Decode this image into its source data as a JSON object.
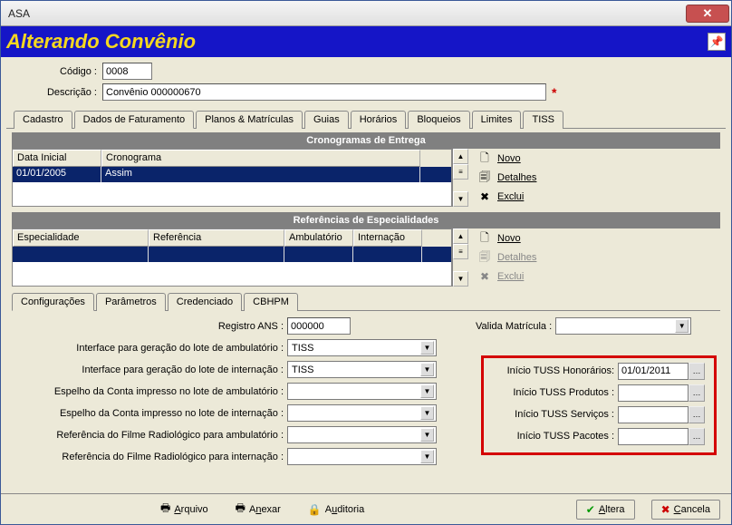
{
  "window": {
    "app_title": "ASA"
  },
  "header": {
    "title": "Alterando Convênio"
  },
  "form": {
    "codigo_label": "Código :",
    "codigo_value": "0008",
    "descricao_label": "Descrição :",
    "descricao_value": "Convênio 000000670"
  },
  "tabs": {
    "cadastro": "Cadastro",
    "dados_fat": "Dados de Faturamento",
    "planos": "Planos & Matrículas",
    "guias": "Guias",
    "horarios": "Horários",
    "bloqueios": "Bloqueios",
    "limites": "Limites",
    "tiss": "TISS"
  },
  "cronogramas": {
    "title": "Cronogramas de Entrega",
    "col_data": "Data Inicial",
    "col_crono": "Cronograma",
    "row0": {
      "data": "01/01/2005",
      "crono": "Assim"
    }
  },
  "refesp": {
    "title": "Referências de Especialidades",
    "col_esp": "Especialidade",
    "col_ref": "Referência",
    "col_amb": "Ambulatório",
    "col_int": "Internação"
  },
  "actions": {
    "novo": "Novo",
    "detalhes": "Detalhes",
    "exclui": "Exclui"
  },
  "subtabs": {
    "config": "Configurações",
    "param": "Parâmetros",
    "cred": "Credenciado",
    "cbhpm": "CBHPM"
  },
  "config": {
    "registro_ans_label": "Registro ANS :",
    "registro_ans_value": "000000",
    "interface_amb_label": "Interface para geração do lote de ambulatório :",
    "interface_amb_value": "TISS",
    "interface_int_label": "Interface para geração do lote de internação :",
    "interface_int_value": "TISS",
    "espelho_amb_label": "Espelho da Conta impresso no lote de ambulatório :",
    "espelho_amb_value": "",
    "espelho_int_label": "Espelho da Conta impresso no lote de internação :",
    "espelho_int_value": "",
    "ref_filme_amb_label": "Referência do Filme Radiológico para ambulatório :",
    "ref_filme_amb_value": "",
    "ref_filme_int_label": "Referência do Filme Radiológico para internação :",
    "ref_filme_int_value": "",
    "valida_matricula_label": "Valida Matrícula :",
    "valida_matricula_value": ""
  },
  "tuss": {
    "honorarios_label": "Início TUSS Honorários:",
    "honorarios_value": "01/01/2011",
    "produtos_label": "Início TUSS Produtos :",
    "produtos_value": "",
    "servicos_label": "Início TUSS Serviços :",
    "servicos_value": "",
    "pacotes_label": "Início TUSS Pacotes :",
    "pacotes_value": ""
  },
  "bottom": {
    "arquivo": "Arquivo",
    "anexar": "Anexar",
    "auditoria": "Auditoria",
    "altera": "Altera",
    "cancela": "Cancela"
  }
}
